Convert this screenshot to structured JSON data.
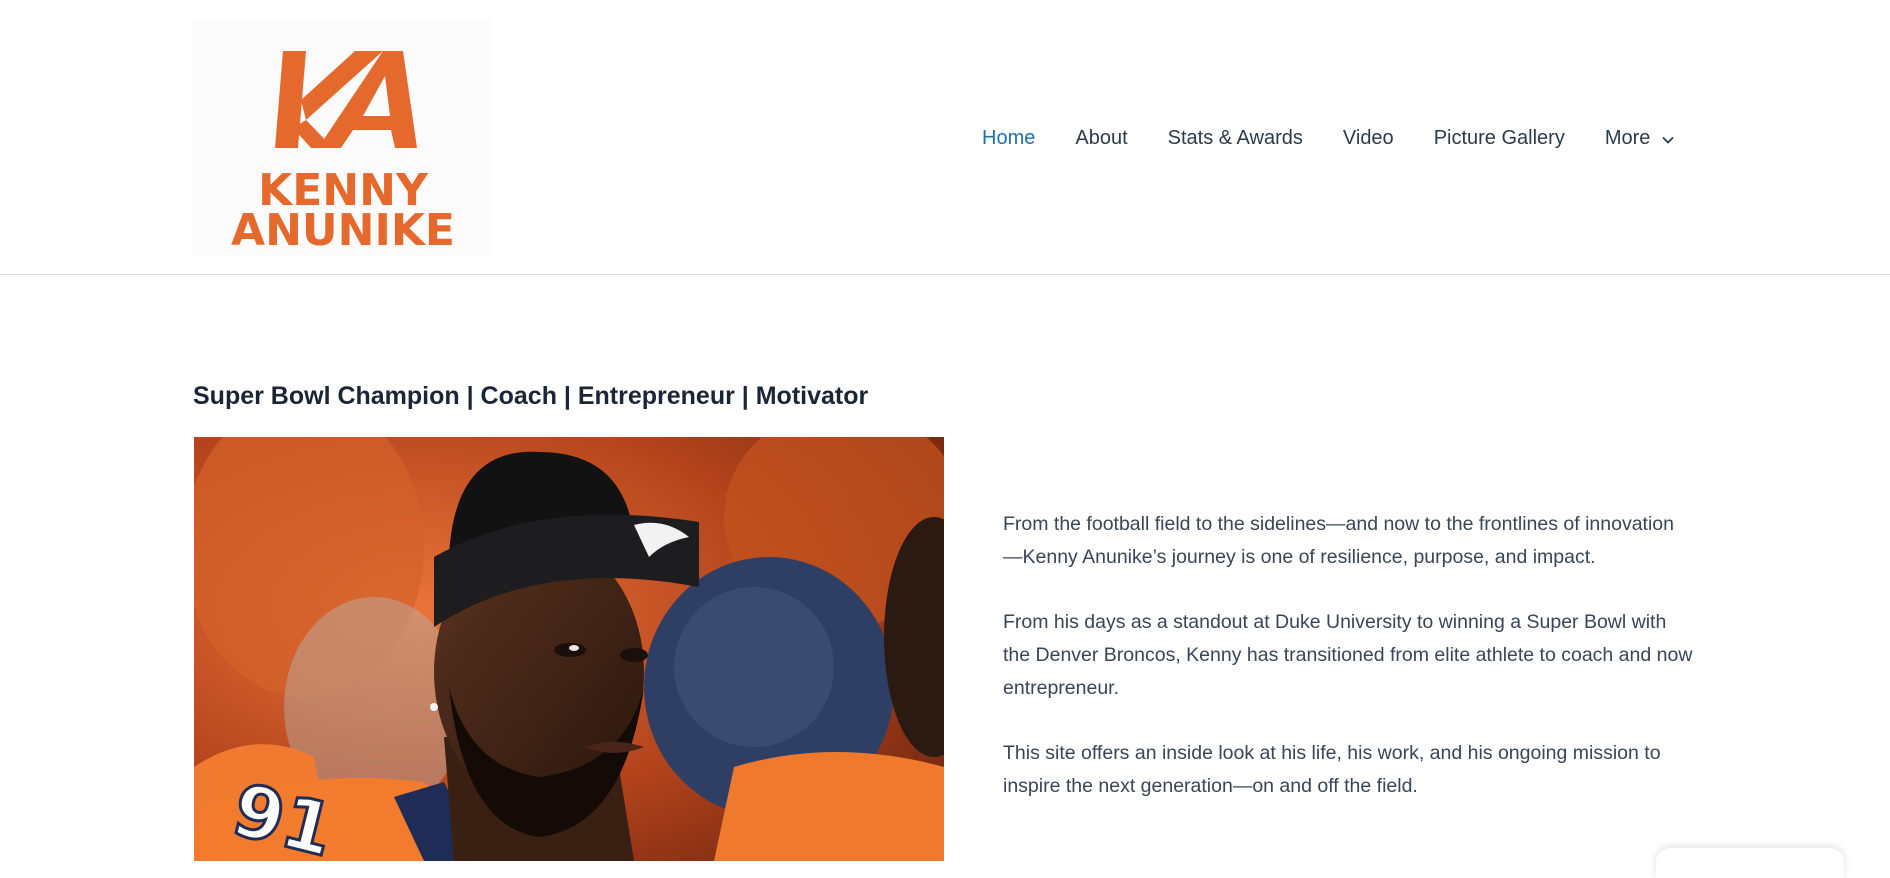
{
  "logo": {
    "monogram": "KA",
    "line1": "KENNY",
    "line2": "ANUNIKE",
    "color": "#e5692c"
  },
  "nav": {
    "items": [
      {
        "label": "Home",
        "active": true
      },
      {
        "label": "About"
      },
      {
        "label": "Stats & Awards"
      },
      {
        "label": "Video"
      },
      {
        "label": "Picture Gallery"
      },
      {
        "label": "More",
        "has_dropdown": true
      }
    ],
    "active_color": "#1e6fb5"
  },
  "main": {
    "headline": "Super Bowl Champion | Coach | Entrepreneur | Motivator",
    "photo": {
      "jersey_number": "91"
    },
    "paragraphs": [
      "From the football field to the sidelines—and now to the frontlines of innovation—Kenny Anunike’s journey is one of resilience, purpose, and impact.",
      "From his days as a standout at Duke University to winning a Super Bowl with the Denver Broncos, Kenny has transitioned from elite athlete to coach and now entrepreneur.",
      "This site offers an inside look at his life, his work, and his ongoing mission to inspire the next generation—on and off the field."
    ]
  }
}
